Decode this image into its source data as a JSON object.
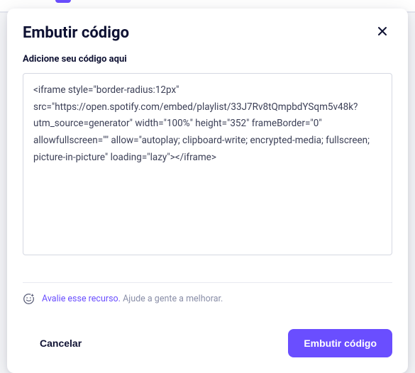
{
  "modal": {
    "title": "Embutir código",
    "field_label": "Adicione seu código aqui",
    "code_value": "<iframe style=\"border-radius:12px\" src=\"https://open.spotify.com/embed/playlist/33J7Rv8tQmpbdYSqm5v48k?utm_source=generator\" width=\"100%\" height=\"352\" frameBorder=\"0\" allowfullscreen=\"\" allow=\"autoplay; clipboard-write; encrypted-media; fullscreen; picture-in-picture\" loading=\"lazy\"></iframe>",
    "feedback": {
      "link_text": "Avalie esse recurso.",
      "sub_text": "Ajude a gente a melhorar."
    },
    "buttons": {
      "cancel": "Cancelar",
      "submit": "Embutir código"
    }
  }
}
